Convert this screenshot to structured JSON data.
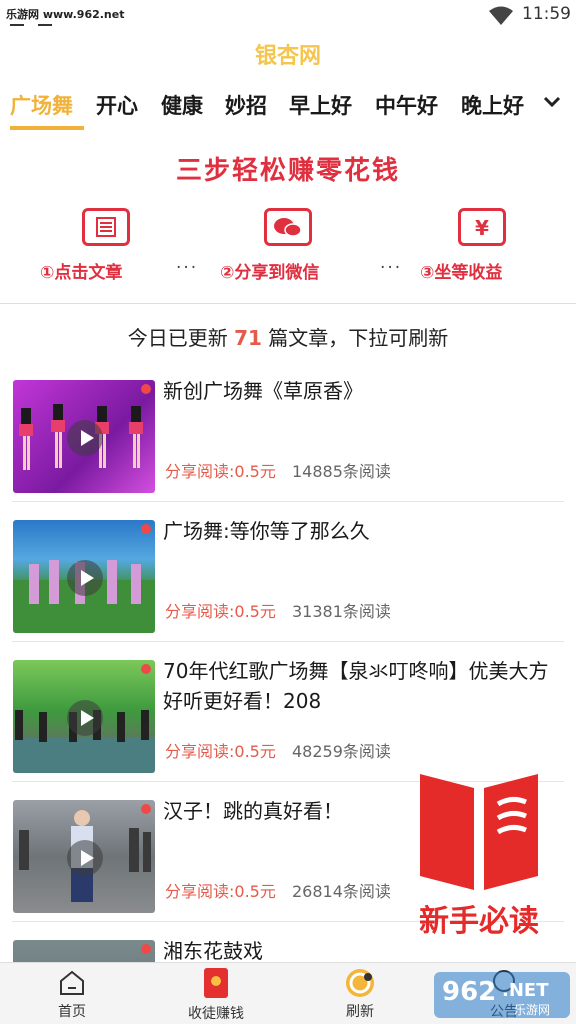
{
  "statusbar": {
    "watermark": "乐游网 www.962.net",
    "time": "11:59"
  },
  "app": {
    "title": "银杏网"
  },
  "tabs": [
    {
      "label": "广场舞",
      "active": true
    },
    {
      "label": "开心"
    },
    {
      "label": "健康"
    },
    {
      "label": "妙招"
    },
    {
      "label": "早上好"
    },
    {
      "label": "中午好"
    },
    {
      "label": "晚上好"
    }
  ],
  "banner": {
    "title": "三步轻松赚零花钱",
    "steps": [
      {
        "label": "①点击文章",
        "icon": "article-icon"
      },
      {
        "label": "②分享到微信",
        "icon": "wechat-icon"
      },
      {
        "label": "③坐等收益",
        "icon": "yuan-icon"
      }
    ],
    "separator": "···"
  },
  "notice": {
    "prefix": "今日已更新",
    "count": "71",
    "suffix": "篇文章，下拉可刷新"
  },
  "articles": [
    {
      "title": "新创广场舞《草原香》",
      "share": "分享阅读:0.5元",
      "reads": "14885条阅读"
    },
    {
      "title": "广场舞:等你等了那么久",
      "share": "分享阅读:0.5元",
      "reads": "31381条阅读"
    },
    {
      "title": "70年代红歌广场舞【泉氺叮咚响】优美大方 好听更好看！208",
      "share": "分享阅读:0.5元",
      "reads": "48259条阅读"
    },
    {
      "title": "汉子！跳的真好看！",
      "share": "分享阅读:0.5元",
      "reads": "26814条阅读"
    },
    {
      "title": "湘东花鼓戏",
      "share": "",
      "reads": ""
    }
  ],
  "newbie": {
    "label": "新手必读"
  },
  "bottomnav": [
    {
      "label": "首页",
      "icon": "home-icon"
    },
    {
      "label": "收徒赚钱",
      "icon": "red-envelope-icon"
    },
    {
      "label": "刷新",
      "icon": "refresh-icon"
    },
    {
      "label": "公告",
      "icon": "notice-icon"
    }
  ],
  "colors": {
    "accent": "#f0b23a",
    "red": "#e03040",
    "title": "#f4c64e"
  }
}
